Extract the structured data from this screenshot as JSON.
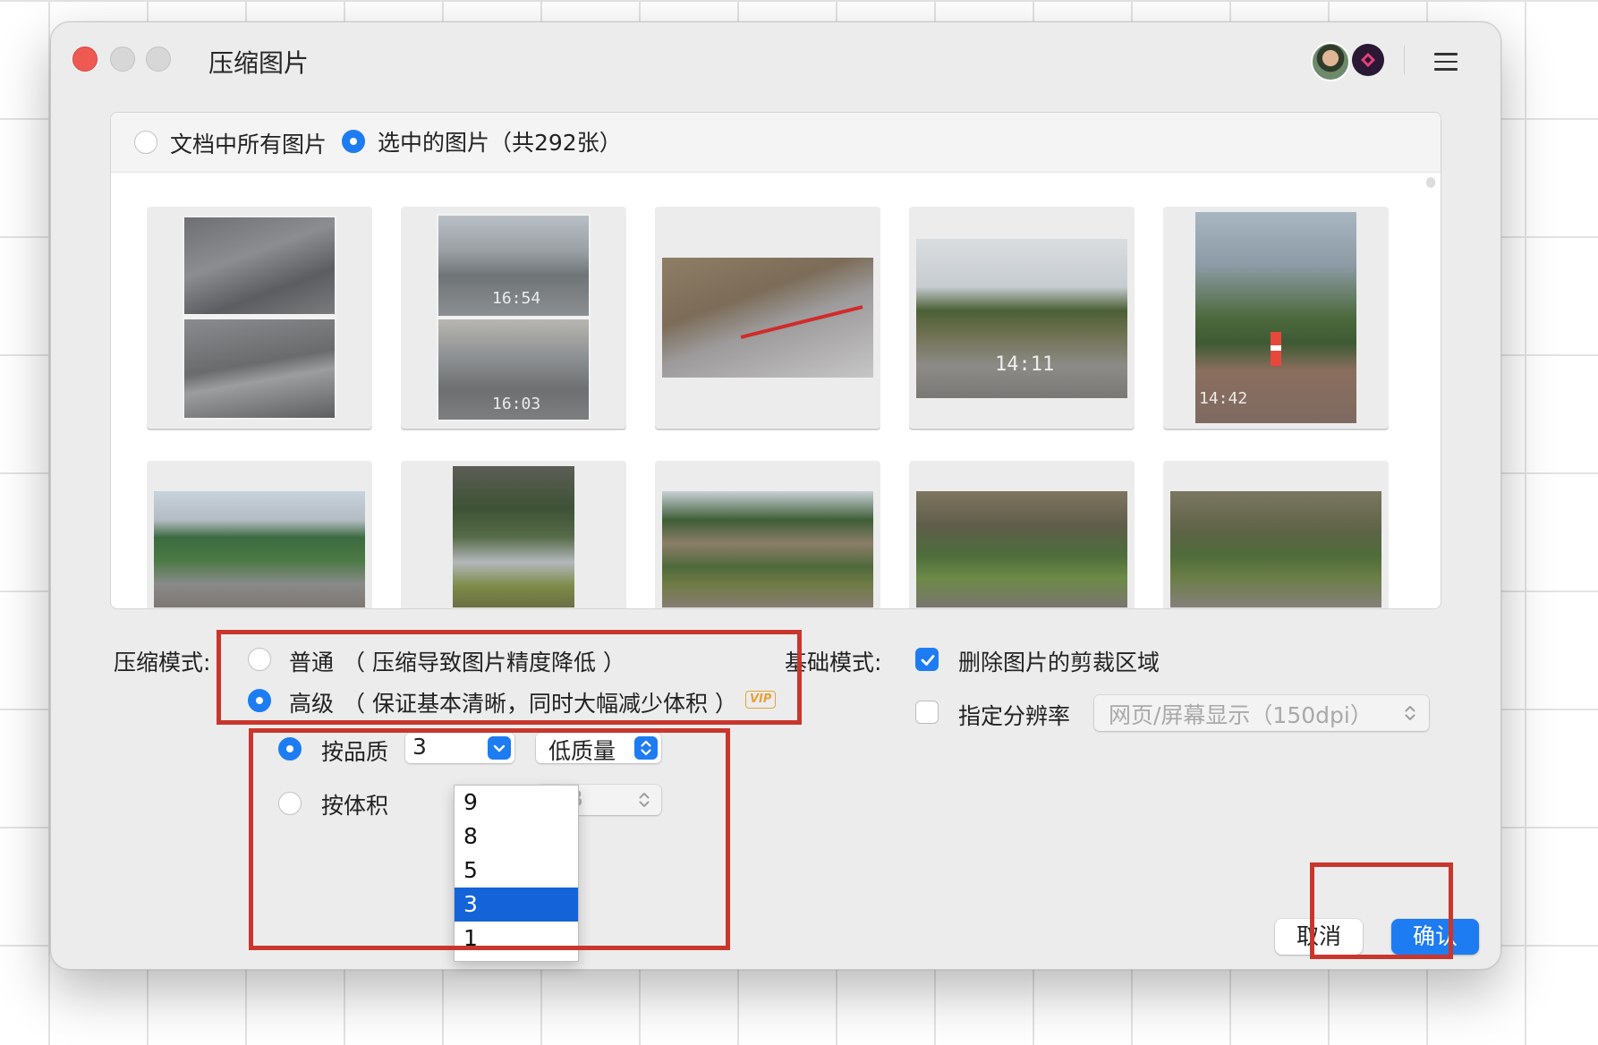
{
  "window": {
    "title": "压缩图片"
  },
  "source": {
    "all_label": "文档中所有图片",
    "selected_label": "选中的图片（共292张）",
    "selected": "selected"
  },
  "thumbnails": [
    {
      "timestamp": ""
    },
    {
      "timestamp": "16:54"
    },
    {
      "timestamp": ""
    },
    {
      "timestamp": "14:11"
    },
    {
      "timestamp": "14:42"
    },
    {
      "timestamp": ""
    },
    {
      "timestamp": ""
    },
    {
      "timestamp": ""
    },
    {
      "timestamp": ""
    },
    {
      "timestamp": ""
    }
  ],
  "second_timestamp": "16:03",
  "compress": {
    "label": "压缩模式:",
    "normal_label": "普通",
    "normal_desc": "（ 压缩导致图片精度降低 ）",
    "advanced_label": "高级",
    "advanced_desc": "（ 保证基本清晰，同时大幅减少体积 ）",
    "vip_badge": "VIP",
    "selected": "advanced"
  },
  "quality": {
    "by_quality_label": "按品质",
    "by_size_label": "按体积",
    "quality_value": "3",
    "quality_level": "低质量",
    "size_unit": "MB",
    "options": [
      "9",
      "8",
      "5",
      "3",
      "1"
    ],
    "selected_option": "3"
  },
  "basic": {
    "label": "基础模式:",
    "delete_crop_label": "删除图片的剪裁区域",
    "delete_crop_checked": true,
    "resolution_label": "指定分辨率",
    "resolution_checked": false,
    "resolution_value": "网页/屏幕显示（150dpi）"
  },
  "buttons": {
    "cancel": "取消",
    "confirm": "确认"
  },
  "colors": {
    "accent": "#1e7cf2",
    "highlight": "#c9362c",
    "close": "#ee5a52"
  }
}
